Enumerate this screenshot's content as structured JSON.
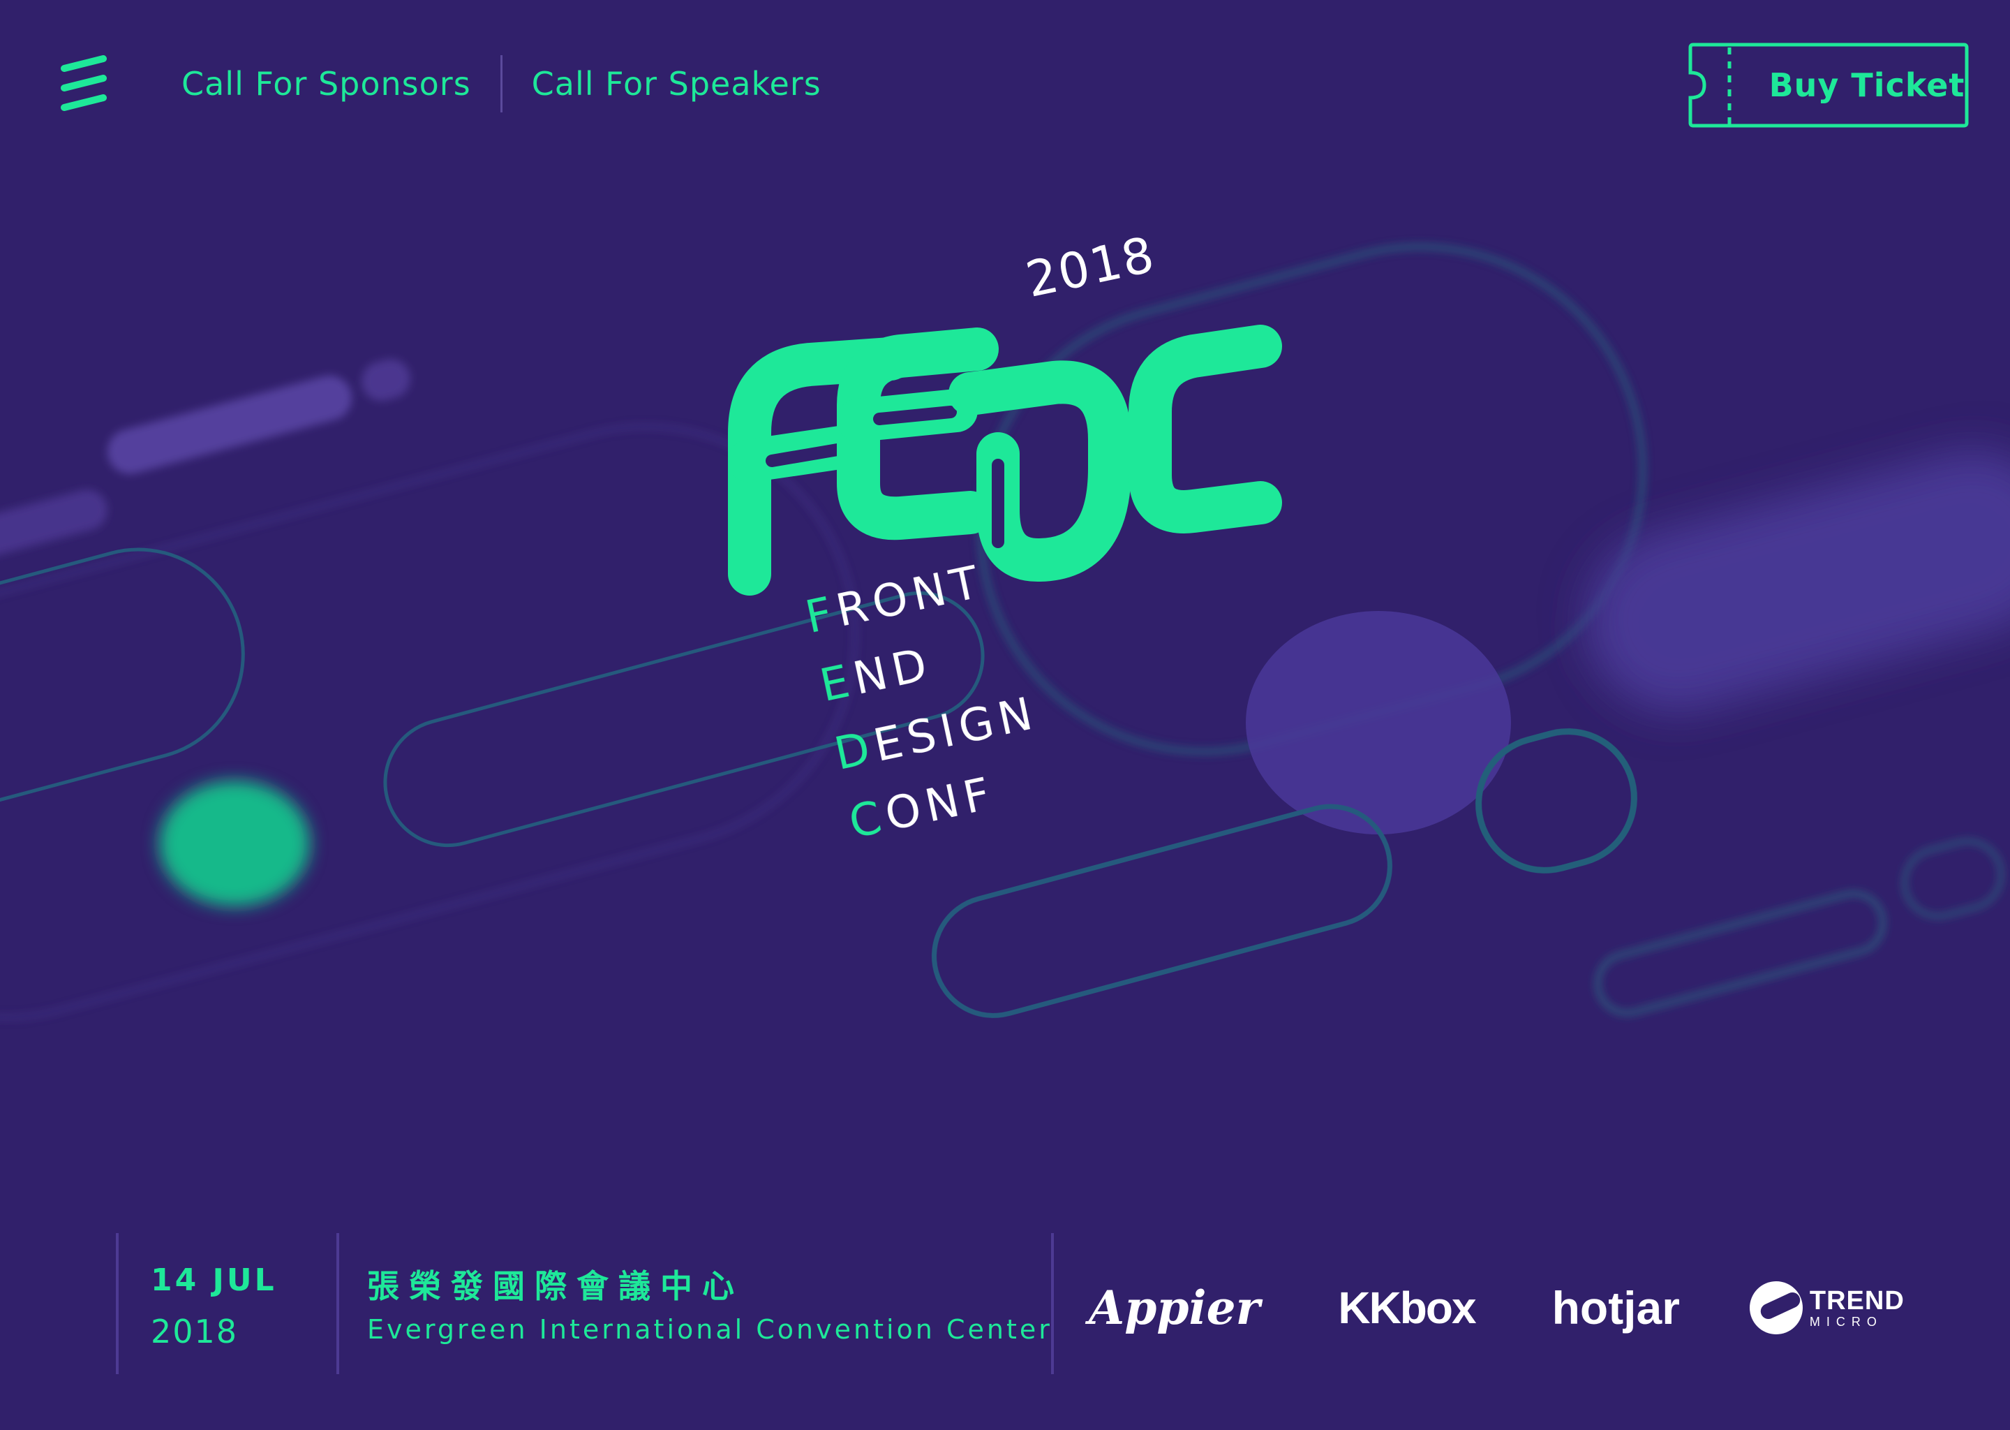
{
  "header": {
    "nav": [
      {
        "label": "Call For Sponsors"
      },
      {
        "label": "Call For Speakers"
      }
    ],
    "ticket_label": "Buy Ticket"
  },
  "hero": {
    "year": "2018",
    "logo_text": "FEDC",
    "tagline": [
      {
        "first": "F",
        "rest": "RONT"
      },
      {
        "first": "E",
        "rest": "ND"
      },
      {
        "first": "D",
        "rest": "ESIGN"
      },
      {
        "first": "C",
        "rest": "ONF"
      }
    ]
  },
  "footer": {
    "date_day": "14 JUL",
    "date_year": "2018",
    "venue_zh": "張榮發國際會議中心",
    "venue_en": "Evergreen International Convention Center",
    "sponsors": {
      "appier": "Appier",
      "kkbox": "KKbox",
      "hotjar": "hotjar",
      "trend_main": "TREND",
      "trend_sub": "MICRO"
    }
  },
  "colors": {
    "background": "#31206b",
    "accent": "#1ee899",
    "text_light": "#ffffff",
    "divider": "#4d3a93"
  }
}
